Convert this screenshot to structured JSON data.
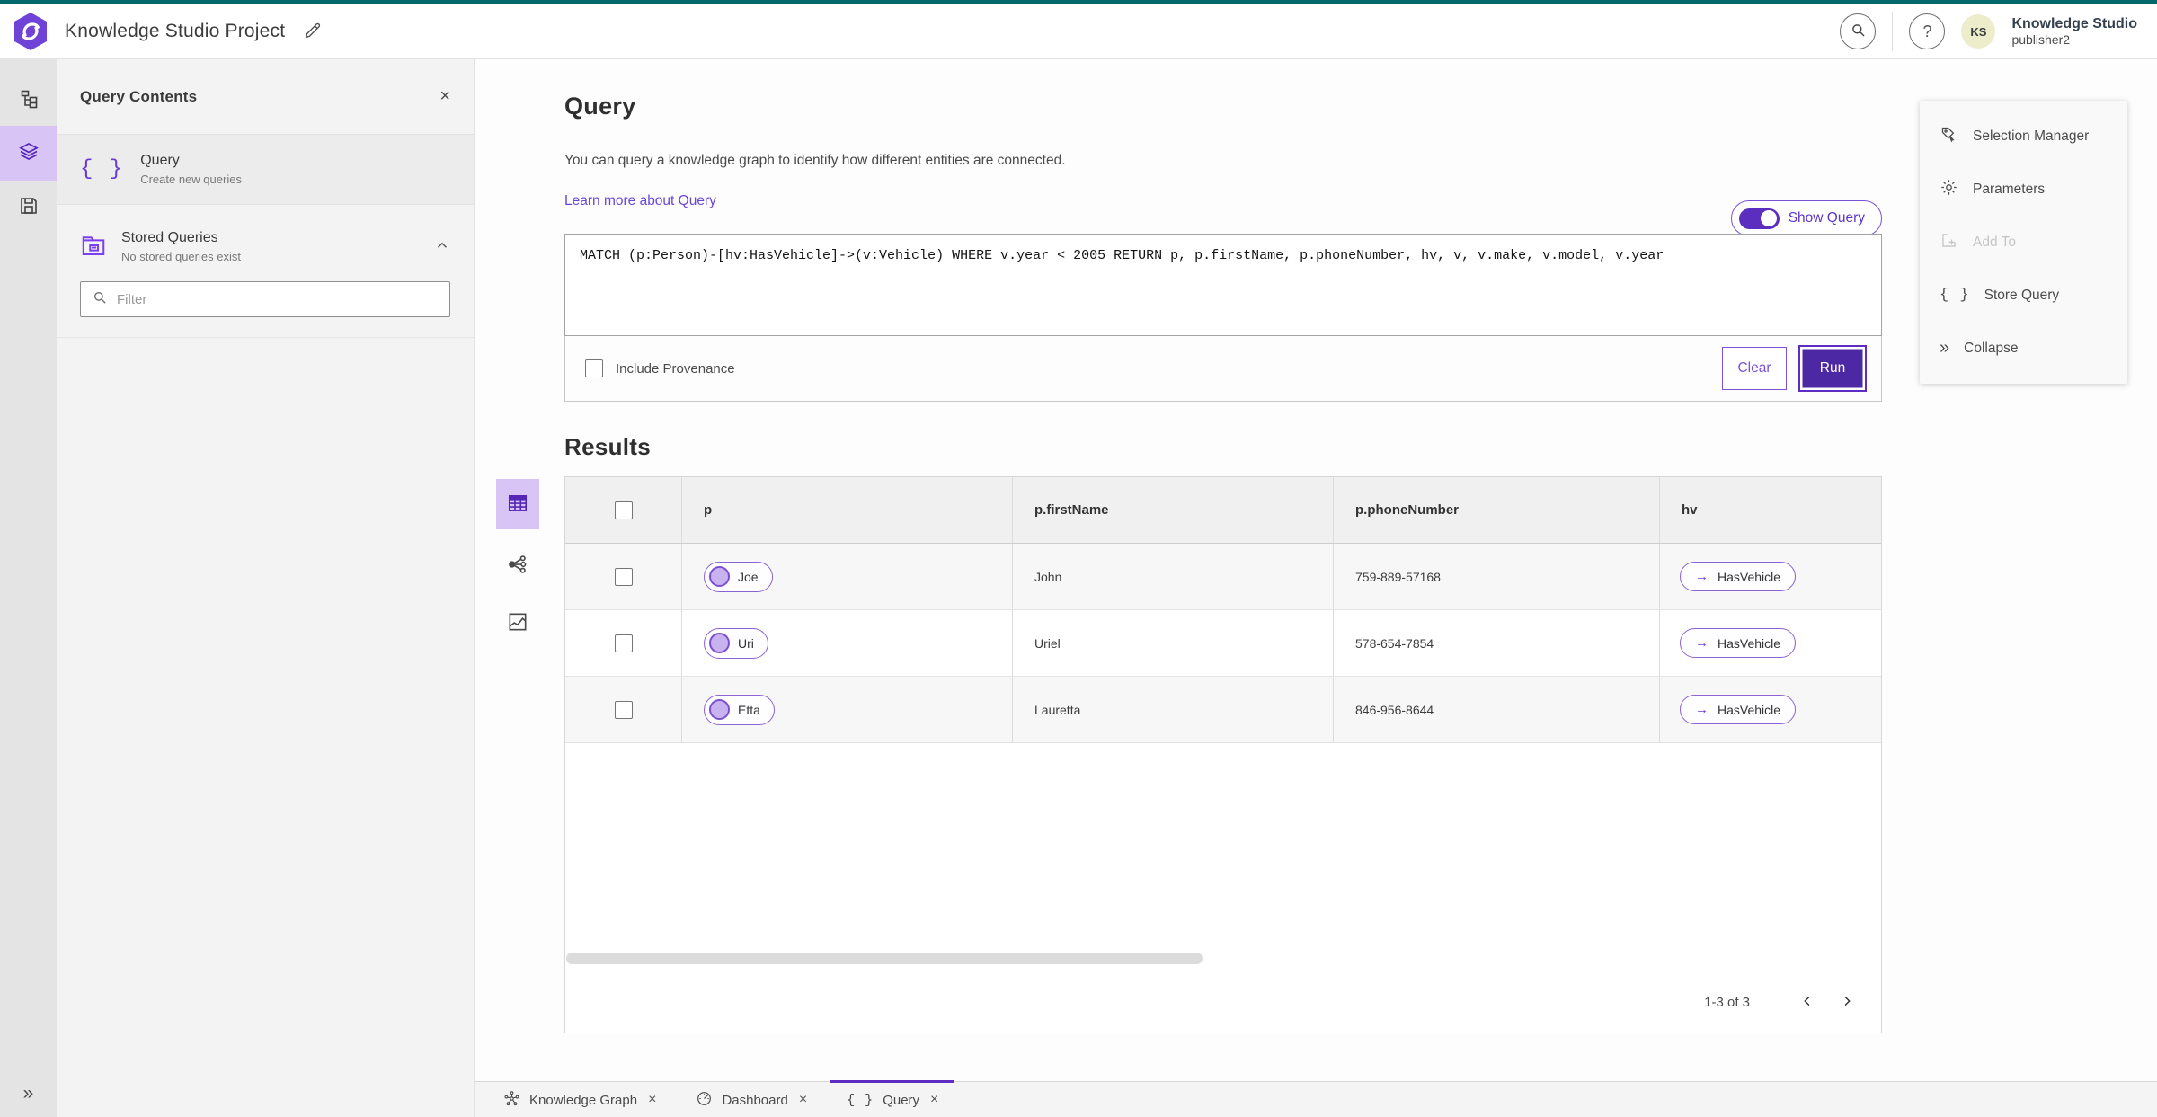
{
  "colors": {
    "accent": "#5e2cc0",
    "accent_deep": "#4c28a4",
    "accent_light": "#d8c5f6",
    "teal_strip": "#05686e",
    "link": "#6a46d8"
  },
  "header": {
    "title": "Knowledge Studio Project",
    "edit_icon": "pencil-icon",
    "search_icon": "search-icon",
    "help_icon": "question-icon",
    "avatar_initials": "KS",
    "user_name": "Knowledge Studio",
    "user_role": "publisher2"
  },
  "rail": {
    "items": [
      {
        "icon": "hierarchy",
        "active": false
      },
      {
        "icon": "layers",
        "active": true
      },
      {
        "icon": "save",
        "active": false
      }
    ],
    "collapse_icon": "double-chevron-right"
  },
  "panel": {
    "title": "Query Contents",
    "close_icon": "close",
    "query_item": {
      "icon": "braces",
      "title": "Query",
      "subtitle": "Create new queries"
    },
    "stored": {
      "icon": "folder",
      "title": "Stored Queries",
      "subtitle": "No stored queries exist",
      "collapse_icon": "chevron-up"
    },
    "filter_placeholder": "Filter"
  },
  "main": {
    "title": "Query",
    "description": "You can query a knowledge graph to identify how different entities are connected.",
    "learn_more": "Learn more about Query",
    "show_query_label": "Show Query",
    "show_query_on": true,
    "query_text": "MATCH (p:Person)-[hv:HasVehicle]->(v:Vehicle) WHERE v.year < 2005 RETURN p, p.firstName, p.phoneNumber, hv, v, v.make, v.model, v.year",
    "include_provenance_label": "Include Provenance",
    "include_provenance_checked": false,
    "clear_label": "Clear",
    "run_label": "Run",
    "results_title": "Results",
    "view_modes": [
      {
        "icon": "table-grid",
        "active": true
      },
      {
        "icon": "link-chart",
        "active": false
      },
      {
        "icon": "map",
        "active": false
      }
    ],
    "table": {
      "columns": [
        "p",
        "p.firstName",
        "p.phoneNumber",
        "hv"
      ],
      "rows": [
        {
          "entity": "Joe",
          "firstName": "John",
          "phone": "759-889-57168",
          "rel": "HasVehicle"
        },
        {
          "entity": "Uri",
          "firstName": "Uriel",
          "phone": "578-654-7854",
          "rel": "HasVehicle"
        },
        {
          "entity": "Etta",
          "firstName": "Lauretta",
          "phone": "846-956-8644",
          "rel": "HasVehicle"
        }
      ]
    },
    "pagination": {
      "label": "1-3 of 3",
      "prev_icon": "chevron-left",
      "next_icon": "chevron-right"
    }
  },
  "right_panel": {
    "items": [
      {
        "label": "Selection Manager",
        "icon": "selection-manager",
        "disabled": false
      },
      {
        "label": "Parameters",
        "icon": "gear",
        "disabled": false
      },
      {
        "label": "Add To",
        "icon": "add-to",
        "disabled": true
      },
      {
        "label": "Store Query",
        "icon": "braces",
        "disabled": false
      },
      {
        "label": "Collapse",
        "icon": "double-chevron-right",
        "disabled": false
      }
    ]
  },
  "tabs": [
    {
      "label": "Knowledge Graph",
      "icon": "knowledge-graph",
      "active": false
    },
    {
      "label": "Dashboard",
      "icon": "gauge",
      "active": false
    },
    {
      "label": "Query",
      "icon": "braces",
      "active": true
    }
  ]
}
